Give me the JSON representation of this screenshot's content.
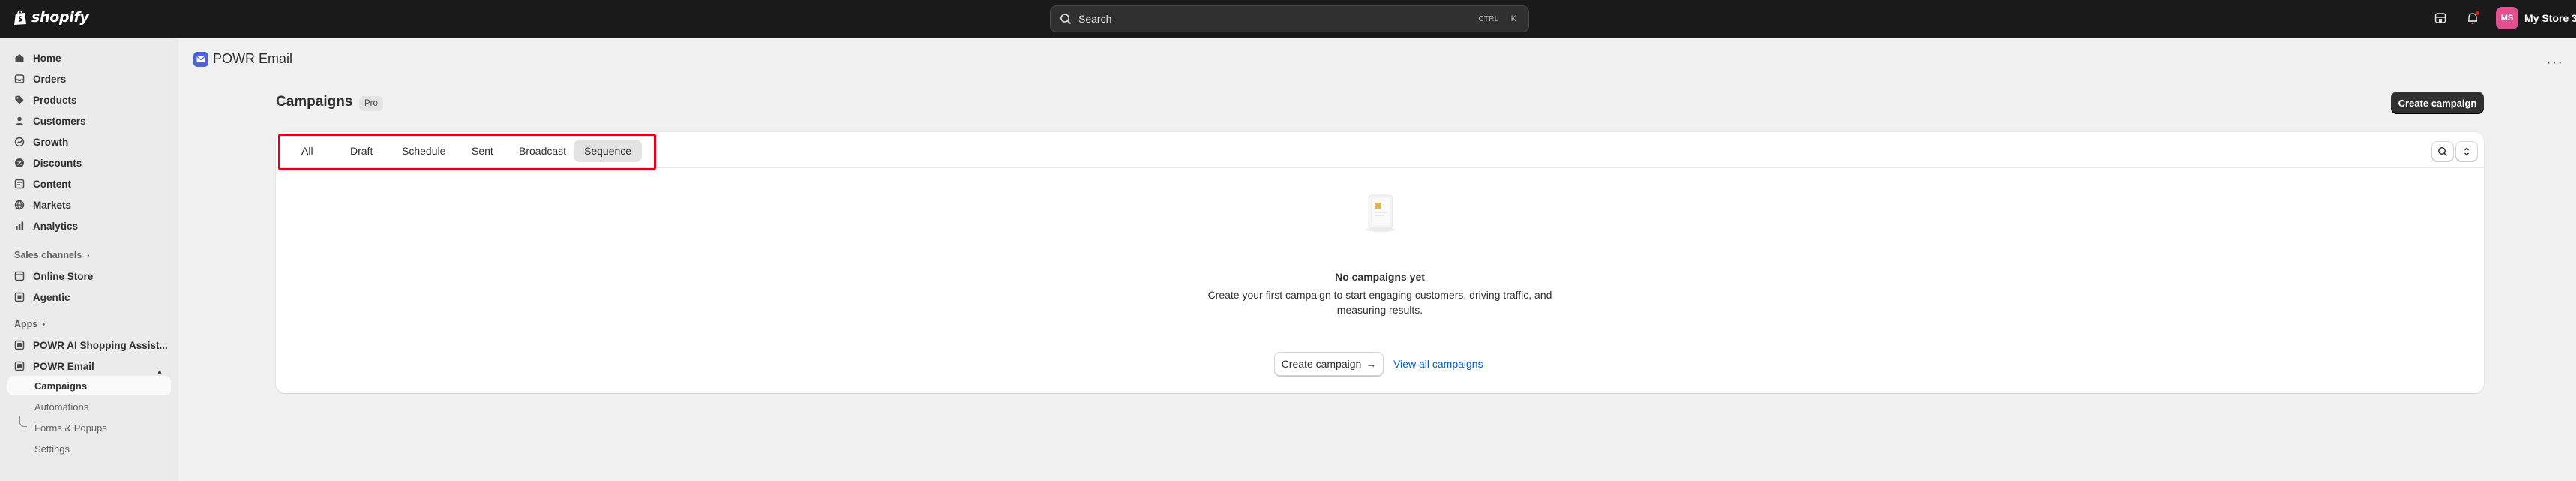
{
  "topbar": {
    "brand": "shopify",
    "search_placeholder": "Search",
    "search_shortcut_mod": "CTRL",
    "search_shortcut_key": "K",
    "avatar_initials": "MS",
    "store_name": "My Store 3",
    "icons": {
      "store": "store-icon",
      "notifications": "bell-icon"
    }
  },
  "sidebar": {
    "items": [
      {
        "label": "Home",
        "icon": "home-icon"
      },
      {
        "label": "Orders",
        "icon": "inbox-icon"
      },
      {
        "label": "Products",
        "icon": "tag-icon"
      },
      {
        "label": "Customers",
        "icon": "person-icon"
      },
      {
        "label": "Growth",
        "icon": "growth-icon"
      },
      {
        "label": "Discounts",
        "icon": "discount-icon"
      },
      {
        "label": "Content",
        "icon": "content-icon"
      },
      {
        "label": "Markets",
        "icon": "globe-icon"
      },
      {
        "label": "Analytics",
        "icon": "chart-icon"
      }
    ],
    "sales_channels_label": "Sales channels",
    "sales_channels": [
      {
        "label": "Online Store",
        "icon": "storefront-icon"
      },
      {
        "label": "Agentic",
        "icon": "agentic-icon"
      }
    ],
    "apps_label": "Apps",
    "apps": [
      {
        "label": "POWR AI Shopping Assist...",
        "icon": "app-icon"
      },
      {
        "label": "POWR Email",
        "icon": "app-icon"
      }
    ],
    "app_subitems": [
      "Campaigns",
      "Automations",
      "Forms & Popups",
      "Settings"
    ]
  },
  "main": {
    "app_title": "POWR Email",
    "page_title": "Campaigns",
    "plan_badge": "Pro",
    "create_button": "Create campaign",
    "tabs": [
      "All",
      "Draft",
      "Schedule",
      "Sent",
      "Broadcast",
      "Sequence"
    ],
    "active_tab": "Sequence",
    "empty_title": "No campaigns yet",
    "empty_description": "Create your first campaign to start engaging customers, driving traffic, and measuring results.",
    "cta_button": "Create campaign",
    "cta_arrow": "→",
    "view_all_link": "View all campaigns"
  },
  "colors": {
    "topbar_bg": "#1a1a1a",
    "sidebar_bg": "#ebebeb",
    "page_bg": "#f1f1f1",
    "primary_button": "#303030",
    "link": "#005bd3",
    "highlight_outline": "#e0001b",
    "avatar": "#e0528f"
  }
}
